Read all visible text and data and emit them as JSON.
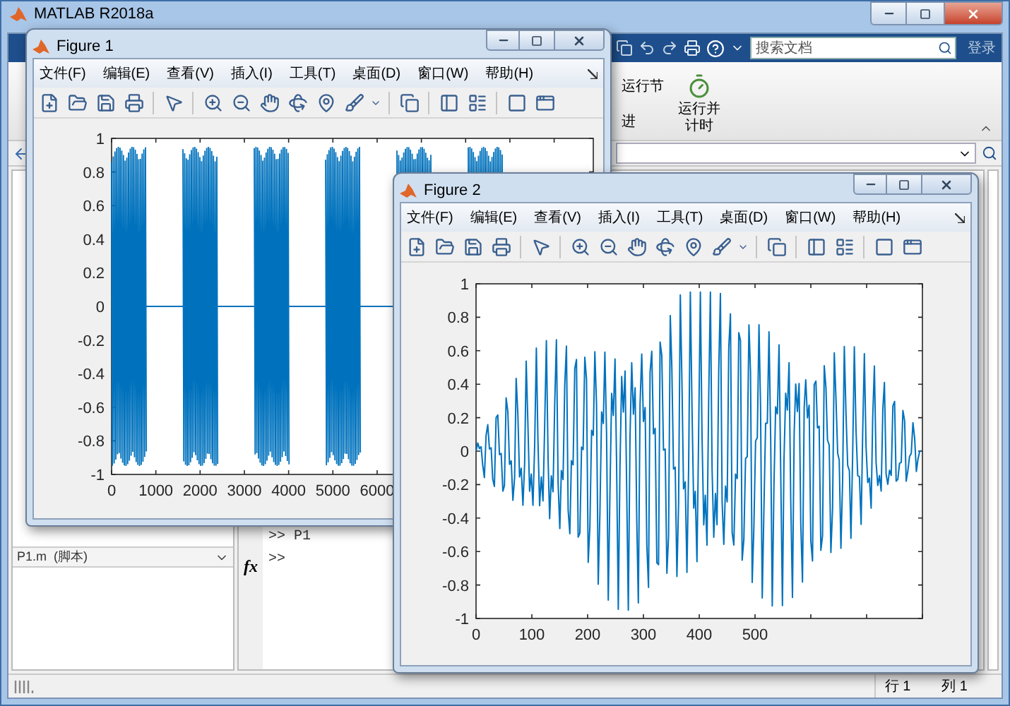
{
  "main_window": {
    "title": "MATLAB R2018a",
    "search": {
      "placeholder": "搜索文档"
    },
    "login": "登录",
    "toolstrip": {
      "run_section": "运行节",
      "advance": "进",
      "run_and_time": [
        "运行并",
        "计时"
      ]
    },
    "current_file": "P1.m  (脚本)",
    "command_window": {
      "function_icon": "fx",
      "lines": [
        ">> P1",
        ">>"
      ]
    },
    "status_bar": {
      "row": "行 1",
      "column": "列 1"
    }
  },
  "figures": [
    {
      "title": "Figure 1",
      "menu": [
        "文件(F)",
        "编辑(E)",
        "查看(V)",
        "插入(I)",
        "工具(T)",
        "桌面(D)",
        "窗口(W)",
        "帮助(H)"
      ],
      "plot": {
        "yticks": [
          "1",
          "0.8",
          "0.6",
          "0.4",
          "0.2",
          "0",
          "-0.2",
          "-0.4",
          "-0.6",
          "-0.8",
          "-1"
        ],
        "xticks": [
          "0",
          "1000",
          "2000",
          "3000",
          "4000",
          "5000",
          "6000"
        ]
      }
    },
    {
      "title": "Figure 2",
      "menu": [
        "文件(F)",
        "编辑(E)",
        "查看(V)",
        "插入(I)",
        "工具(T)",
        "桌面(D)",
        "窗口(W)",
        "帮助(H)"
      ],
      "plot": {
        "yticks": [
          "1",
          "0.8",
          "0.6",
          "0.4",
          "0.2",
          "0",
          "-0.2",
          "-0.4",
          "-0.6",
          "-0.8",
          "-1"
        ],
        "xticks": [
          "0",
          "100",
          "200",
          "300",
          "400",
          "500"
        ]
      }
    }
  ]
}
